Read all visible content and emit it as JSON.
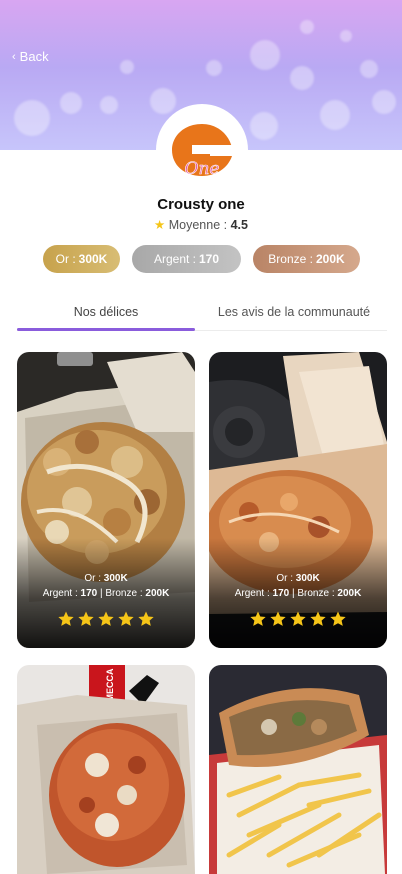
{
  "header": {
    "back_label": "Back"
  },
  "restaurant": {
    "name": "Crousty one",
    "logo_text": "One",
    "rating_label": "Moyenne :",
    "rating_value": "4.5"
  },
  "prices": {
    "or_label": "Or :",
    "or_value": "300K",
    "argent_label": "Argent :",
    "argent_value": "170",
    "bronze_label": "Bronze :",
    "bronze_value": "200K"
  },
  "tabs": [
    {
      "label": "Nos délices",
      "active": true
    },
    {
      "label": "Les avis de la communauté",
      "active": false
    }
  ],
  "cards": [
    {
      "or_label": "Or :",
      "or_value": "300K",
      "argent_label": "Argent :",
      "argent_value": "170",
      "separator": " | ",
      "bronze_label": "Bronze :",
      "bronze_value": "200K",
      "stars": 5
    },
    {
      "or_label": "Or :",
      "or_value": "300K",
      "argent_label": "Argent :",
      "argent_value": "170",
      "separator": " | ",
      "bronze_label": "Bronze :",
      "bronze_value": "200K",
      "stars": 5
    },
    {
      "cup_label": "MECCA"
    },
    {}
  ],
  "colors": {
    "accent": "#8a5cdc",
    "or": "#c7a24c",
    "argent": "#a8a8a8",
    "bronze": "#b98466",
    "logo_orange": "#e8751a",
    "logo_pink": "#e25aa5",
    "star": "#f5c518"
  }
}
